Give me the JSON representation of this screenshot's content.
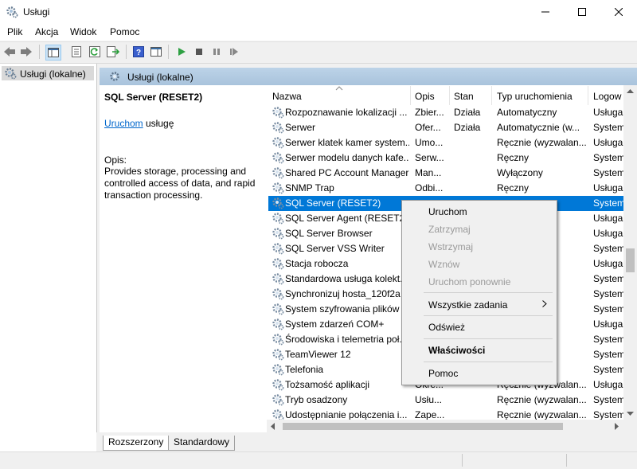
{
  "window": {
    "title": "Usługi"
  },
  "menu": [
    "Plik",
    "Akcja",
    "Widok",
    "Pomoc"
  ],
  "tree": {
    "item": "Usługi (lokalne)"
  },
  "pane": {
    "header": "Usługi (lokalne)"
  },
  "details": {
    "service_name": "SQL Server (RESET2)",
    "start_link": "Uruchom",
    "start_rest": "usługę",
    "desc_label": "Opis:",
    "description": "Provides storage, processing and controlled access of data, and rapid transaction processing."
  },
  "columns": [
    "Nazwa",
    "Opis",
    "Stan",
    "Typ uruchomienia",
    "Logow"
  ],
  "rows": [
    {
      "name": "Rozpoznawanie lokalizacji ...",
      "desc": "Zbier...",
      "state": "Działa",
      "startup": "Automatyczny",
      "logon": "Usługa"
    },
    {
      "name": "Serwer",
      "desc": "Ofer...",
      "state": "Działa",
      "startup": "Automatycznie (w...",
      "logon": "System"
    },
    {
      "name": "Serwer klatek kamer system...",
      "desc": "Umo...",
      "state": "",
      "startup": "Ręcznie (wyzwalan...",
      "logon": "Usługa"
    },
    {
      "name": "Serwer modelu danych kafe...",
      "desc": "Serw...",
      "state": "",
      "startup": "Ręczny",
      "logon": "System"
    },
    {
      "name": "Shared PC Account Manager",
      "desc": "Man...",
      "state": "",
      "startup": "Wyłączony",
      "logon": "System"
    },
    {
      "name": "SNMP Trap",
      "desc": "Odbi...",
      "state": "",
      "startup": "Ręczny",
      "logon": "Usługa"
    },
    {
      "name": "SQL Server (RESET2)",
      "desc": "",
      "state": "",
      "startup": "",
      "logon": "System",
      "selected": true
    },
    {
      "name": "SQL Server Agent (RESET2)",
      "desc": "",
      "state": "",
      "startup": "",
      "logon": "Usługa"
    },
    {
      "name": "SQL Server Browser",
      "desc": "",
      "state": "",
      "startup": "",
      "logon": "Usługa"
    },
    {
      "name": "SQL Server VSS Writer",
      "desc": "",
      "state": "",
      "startup": "",
      "logon": "System"
    },
    {
      "name": "Stacja robocza",
      "desc": "",
      "state": "",
      "startup": "",
      "logon": "Usługa"
    },
    {
      "name": "Standardowa usługa kolekt...",
      "desc": "",
      "state": "",
      "startup": "",
      "logon": "System"
    },
    {
      "name": "Synchronizuj hosta_120f2a",
      "desc": "",
      "state": "",
      "startup": "e (op...",
      "logon": "System"
    },
    {
      "name": "System szyfrowania plików ...",
      "desc": "",
      "state": "",
      "startup": "",
      "logon": "System"
    },
    {
      "name": "System zdarzeń COM+",
      "desc": "",
      "state": "",
      "startup": "",
      "logon": "Usługa"
    },
    {
      "name": "Środowiska i telemetria poł...",
      "desc": "",
      "state": "",
      "startup": "",
      "logon": "System"
    },
    {
      "name": "TeamViewer 12",
      "desc": "",
      "state": "",
      "startup": "",
      "logon": "System"
    },
    {
      "name": "Telefonia",
      "desc": "",
      "state": "",
      "startup": "",
      "logon": "System"
    },
    {
      "name": "Tożsamość aplikacji",
      "desc": "Okre...",
      "state": "",
      "startup": "Ręcznie (wyzwalan...",
      "logon": "Usługa"
    },
    {
      "name": "Tryb osadzony",
      "desc": "Usłu...",
      "state": "",
      "startup": "Ręcznie (wyzwalan...",
      "logon": "System"
    },
    {
      "name": "Udostępnianie połączenia i...",
      "desc": "Zape...",
      "state": "",
      "startup": "Ręcznie (wyzwalan...",
      "logon": "System"
    }
  ],
  "context_menu": {
    "start": "Uruchom",
    "stop": "Zatrzymaj",
    "pause": "Wstrzymaj",
    "resume": "Wznów",
    "restart": "Uruchom ponownie",
    "all_tasks": "Wszystkie zadania",
    "refresh": "Odśwież",
    "properties": "Właściwości",
    "help": "Pomoc"
  },
  "tabs": [
    "Rozszerzony",
    "Standardowy"
  ],
  "colors": {
    "selection": "#0078d7",
    "link": "#0066cc",
    "header": "#bcd3e8"
  }
}
